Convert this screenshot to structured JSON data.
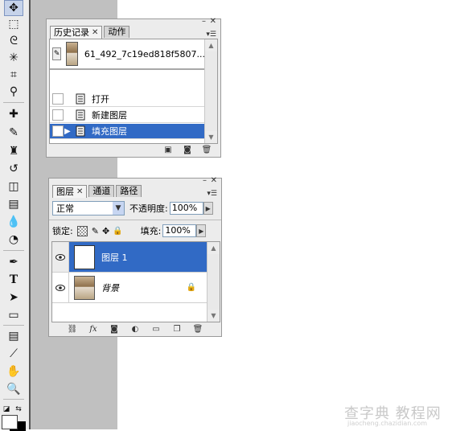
{
  "history_panel": {
    "tabs": [
      {
        "label": "历史记录",
        "active": true
      },
      {
        "label": "动作",
        "active": false
      }
    ],
    "snapshot_name": "61_492_7c19ed818f5807...",
    "items": [
      {
        "label": "打开",
        "selected": false
      },
      {
        "label": "新建图层",
        "selected": false
      },
      {
        "label": "填充图层",
        "selected": true
      }
    ],
    "bottom_icons": [
      "new-document-from-state-icon",
      "new-snapshot-icon",
      "delete-icon"
    ]
  },
  "layers_panel": {
    "tabs": [
      {
        "label": "图层",
        "active": true
      },
      {
        "label": "通道",
        "active": false
      },
      {
        "label": "路径",
        "active": false
      }
    ],
    "blend_mode": "正常",
    "opacity_label": "不透明度:",
    "opacity_value": "100%",
    "lock_label": "锁定:",
    "fill_label": "填充:",
    "fill_value": "100%",
    "layers": [
      {
        "name": "图层 1",
        "selected": true,
        "visible": true,
        "locked": false
      },
      {
        "name": "背景",
        "selected": false,
        "visible": true,
        "locked": true
      }
    ],
    "bottom_icons": [
      "link-icon",
      "fx-icon",
      "mask-icon",
      "adjustment-icon",
      "group-icon",
      "new-layer-icon",
      "delete-icon"
    ]
  },
  "toolbar": {
    "tools": [
      "move-icon",
      "marquee-icon",
      "lasso-icon",
      "magic-wand-icon",
      "crop-icon",
      "slice-icon",
      "healing-icon",
      "brush-icon",
      "stamp-icon",
      "history-brush-icon",
      "eraser-icon",
      "gradient-icon",
      "blur-icon",
      "dodge-icon",
      "pen-icon",
      "type-icon",
      "path-select-icon",
      "shape-icon",
      "notes-icon",
      "eyedropper-icon",
      "hand-icon",
      "zoom-icon"
    ]
  },
  "watermark": {
    "main": "查字典 教程网",
    "sub": "jiaocheng.chazidian.com"
  },
  "colors": {
    "selection": "#316ac5",
    "panel_bg": "#ececec",
    "workspace_gray": "#c0c0c0"
  }
}
